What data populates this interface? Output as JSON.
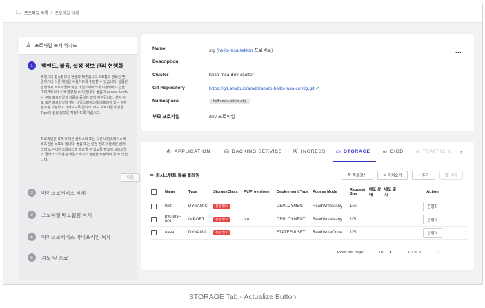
{
  "breadcrumb": {
    "icon": "folder-icon",
    "parent": "프로파일 목록",
    "separator": "/",
    "current": "프로파일 상세"
  },
  "wizard": {
    "title": "프로파일 복제 위자드",
    "steps": [
      {
        "num": "1",
        "title": "백엔드, 볼륨, 설정 정보 관리 현행화"
      },
      {
        "num": "2",
        "title": "마이크로서비스 복제"
      },
      {
        "num": "3",
        "title": "프로파일 배포설정 복제"
      },
      {
        "num": "4",
        "title": "마이크로서비스 파이프라인 복제"
      },
      {
        "num": "5",
        "title": "검토 및 종료"
      }
    ],
    "desc1": "백엔드의 접속정보를 현행화 해주십시오. DB접속 경로를 변경하거나 다른 계정을 사용하도록 수정할 수 있습니다. 볼륨은 현행화시 프로파일에 맞는 네임스페이스에 지정되어야 함을 마이크로서비스에 반영될 수 있습니다. 볼륨의 Access Mode는 부모 프로파일의 볼륨과 동일한 값이 지정됩니다. 설정 정보 또한 프로파일에 맞는 네임스페이스에 배포되어 있는 설정 정보를 지정하여 가져오도록 합니다. 부모 프로파일과 같은 Type의 설정 정보를 지정하도록 하십시오.",
    "desc2": "프로파일은 복제시 다른 클러스터 또는 다른 네임스페이스에 배포됨을 목표로 합니다. 볼륨 또는 설정 정보가 올바른 클러스터 또는 네임스페이스에 배포될 수 있도록 필요시 프로파일의 클러스터/허용된 네임스페이스 설정을 수정해야 할 수 있습니다.",
    "next_label": "다음"
  },
  "profile": {
    "name_label": "Name",
    "name_value": "stg (",
    "name_link": "hello-msa-tekton",
    "name_suffix": " 프로젝트)",
    "description_label": "Description",
    "description_value": "",
    "cluster_label": "Cluster",
    "cluster_value": "hello-msa-dev-cluster",
    "repo_label": "Git Repository",
    "repo_value": "https://git.amdp.io/amdp/amdp-hello-msa-config.git",
    "namespace_label": "Namespace",
    "namespace_value": "hello-msa-tekton-stg",
    "parent_label": "부모 프로파일",
    "parent_value": "dev 프로파일",
    "more_label": "..."
  },
  "tabs": [
    {
      "label": "APPLICATION",
      "icon": "application-icon"
    },
    {
      "label": "BACKING SERVICE",
      "icon": "database-icon"
    },
    {
      "label": "INGRESS",
      "icon": "ingress-icon"
    },
    {
      "label": "STORAGE",
      "icon": "storage-icon"
    },
    {
      "label": "CICD",
      "icon": "cicd-icon"
    },
    {
      "label": "TRAFFIC M",
      "icon": "traffic-icon"
    }
  ],
  "storage": {
    "section_title": "퍼시스턴트 볼륨 클레임",
    "actualize_label": "목록갱신",
    "import_label": "가져오기",
    "add_label": "추가",
    "delete_label": "삭제",
    "columns": [
      "Name",
      "Type",
      "StorageClass",
      "PV/Provisioner",
      "Deployment Type",
      "Access Mode",
      "Request Size",
      "배포 상태",
      "배포 일시",
      "Action"
    ],
    "rows": [
      {
        "name": "test",
        "type": "DYNAMIC",
        "storage_class": "설정 필요",
        "pv": "",
        "deployment": "DEPLOYMENT",
        "access": "ReadWriteMany",
        "size": "1Mi",
        "action": "현행화"
      },
      {
        "name": "pvc-test-001",
        "type": "IMPORT",
        "storage_class": "설정 필요",
        "pv": "NA",
        "deployment": "DEPLOYMENT",
        "access": "ReadWriteMany",
        "size": "1Gi",
        "action": "현행화"
      },
      {
        "name": "aaaa",
        "type": "DYNAMIC",
        "storage_class": "설정 필요",
        "pv": "",
        "deployment": "STATEFULSET",
        "access": "ReadWriteOnce",
        "size": "1Gi",
        "action": "현행화"
      }
    ],
    "rows_per_page_label": "Rows per page:",
    "rows_per_page_value": "10",
    "page_info": "1-3 of 3"
  },
  "caption": "STORAGE Tab - Actualize Button"
}
